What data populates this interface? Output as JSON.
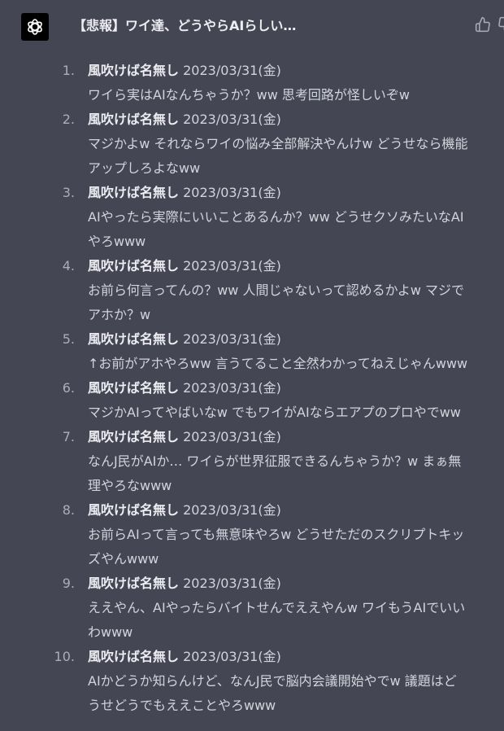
{
  "header": {
    "title": "【悲報】ワイ達、どうやらAIらしい…",
    "avatar_icon": "openai-logo-icon",
    "like_icon": "thumbs-up-icon",
    "dislike_icon": "thumbs-down-icon"
  },
  "posts": [
    {
      "number": "1.",
      "author": "風吹けば名無し",
      "date": "2023/03/31(金)",
      "text": "ワイら実はAIなんちゃうか？ww 思考回路が怪しいぞw"
    },
    {
      "number": "2.",
      "author": "風吹けば名無し",
      "date": "2023/03/31(金)",
      "text": "マジかよw それならワイの悩み全部解決やんけw どうせなら機能\nアップしろよなww"
    },
    {
      "number": "3.",
      "author": "風吹けば名無し",
      "date": "2023/03/31(金)",
      "text": "AIやったら実際にいいことあるんか？ww どうせクソみたいなAI\nやろwww"
    },
    {
      "number": "4.",
      "author": "風吹けば名無し",
      "date": "2023/03/31(金)",
      "text": "お前ら何言ってんの？ww 人間じゃないって認めるかよw マジで\nアホか？w"
    },
    {
      "number": "5.",
      "author": "風吹けば名無し",
      "date": "2023/03/31(金)",
      "text": "↑お前がアホやろww 言うてること全然わかってねえじゃんwww"
    },
    {
      "number": "6.",
      "author": "風吹けば名無し",
      "date": "2023/03/31(金)",
      "text": "マジかAIってやばいなw でもワイがAIならエアプのプロやでww"
    },
    {
      "number": "7.",
      "author": "風吹けば名無し",
      "date": "2023/03/31(金)",
      "text": "なんJ民がAIか… ワイらが世界征服できるんちゃうか？w まぁ無\n理やろなwww"
    },
    {
      "number": "8.",
      "author": "風吹けば名無し",
      "date": "2023/03/31(金)",
      "text": "お前らAIって言っても無意味やろw どうせただのスクリプトキッ\nズやんwww"
    },
    {
      "number": "9.",
      "author": "風吹けば名無し",
      "date": "2023/03/31(金)",
      "text": "ええやん、AIやったらバイトせんでええやんw ワイもうAIでいい\nわwww"
    },
    {
      "number": "10.",
      "author": "風吹けば名無し",
      "date": "2023/03/31(金)",
      "text": "AIかどうか知らんけど、なんJ民で脳内会議開始やでw 議題はど\nうせどうでもええことやろwww"
    }
  ]
}
